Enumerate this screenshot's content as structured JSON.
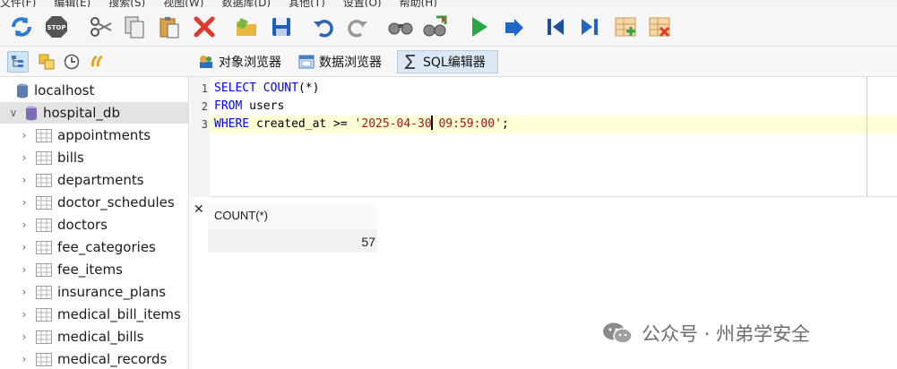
{
  "menu": {
    "items": [
      "文件(F)",
      "编辑(E)",
      "搜索(S)",
      "视图(W)",
      "数据库(D)",
      "其他(T)",
      "设置(O)",
      "帮助(H)"
    ]
  },
  "toolbar": {
    "buttons": [
      "refresh-icon",
      "stop-icon",
      "cut-icon",
      "copy-icon",
      "paste-icon",
      "delete-icon",
      "open-folder-icon",
      "save-icon",
      "undo-icon",
      "redo-icon",
      "find-icon",
      "replace-icon",
      "execute-icon",
      "execute-current-icon",
      "first-icon",
      "last-icon",
      "add-row-icon",
      "delete-row-icon"
    ]
  },
  "toolbar2": {
    "buttons": [
      "tree-icon",
      "filter-icon",
      "history-icon",
      "link-icon"
    ],
    "tabs": [
      {
        "label": "对象浏览器",
        "icon": "object-browser-icon"
      },
      {
        "label": "数据浏览器",
        "icon": "data-browser-icon"
      },
      {
        "label": "SQL编辑器",
        "icon": "sql-editor-icon",
        "active": true
      }
    ]
  },
  "tree": {
    "host": "localhost",
    "database": "hospital_db",
    "tables": [
      "appointments",
      "bills",
      "departments",
      "doctor_schedules",
      "doctors",
      "fee_categories",
      "fee_items",
      "insurance_plans",
      "medical_bill_items",
      "medical_bills",
      "medical_records"
    ]
  },
  "editor": {
    "lines": [
      {
        "num": "1",
        "tokens": [
          {
            "t": "SELECT",
            "c": "kw"
          },
          {
            "t": " ",
            "c": "ident"
          },
          {
            "t": "COUNT",
            "c": "kw"
          },
          {
            "t": "(*)",
            "c": "ident"
          }
        ]
      },
      {
        "num": "2",
        "tokens": [
          {
            "t": "FROM",
            "c": "kw"
          },
          {
            "t": " users",
            "c": "ident"
          }
        ]
      },
      {
        "num": "3",
        "tokens": [
          {
            "t": "WHERE",
            "c": "kw"
          },
          {
            "t": " created_at >= ",
            "c": "ident"
          },
          {
            "t": "'2025-04-30",
            "c": "str"
          },
          {
            "t": "|caret|",
            "c": "caret"
          },
          {
            "t": " 09:59:00'",
            "c": "str"
          },
          {
            "t": ";",
            "c": "ident"
          }
        ]
      }
    ],
    "current_line": 3
  },
  "results": {
    "columns": [
      "COUNT(*)"
    ],
    "rows": [
      [
        "57"
      ]
    ]
  },
  "watermark": {
    "text": "公众号 · 州弟学安全"
  },
  "colors": {
    "keyword": "#0000ff",
    "string": "#a31515",
    "current_line": "#ffffd6"
  }
}
